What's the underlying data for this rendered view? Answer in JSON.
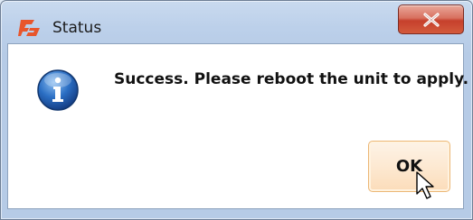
{
  "window": {
    "title": "Status",
    "close_icon": "close-icon"
  },
  "dialog": {
    "icon": "info-icon",
    "message": "Success. Please reboot the unit to apply.",
    "ok_label": "OK"
  },
  "colors": {
    "close_button": "#c6402c",
    "ok_button_border": "#ecb776",
    "info_icon": "#2b6fc4",
    "app_icon": "#e8562c"
  }
}
